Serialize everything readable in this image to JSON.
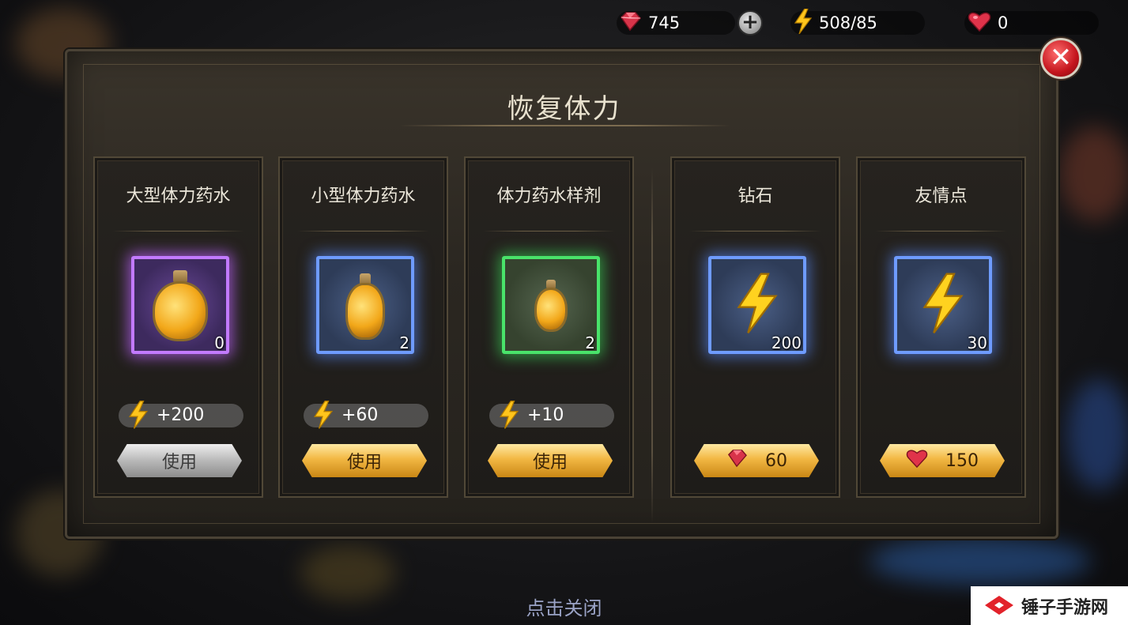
{
  "topbar": {
    "gems": "745",
    "energy": "508/85",
    "friendship": "0"
  },
  "dialog": {
    "title": "恢复体力",
    "close_hint": "点击关闭"
  },
  "items": [
    {
      "name": "大型体力药水",
      "count": "0",
      "bonus": "+200",
      "button": "使用",
      "rarity": "purple",
      "button_state": "disabled"
    },
    {
      "name": "小型体力药水",
      "count": "2",
      "bonus": "+60",
      "button": "使用",
      "rarity": "blue",
      "button_state": "enabled"
    },
    {
      "name": "体力药水样剂",
      "count": "2",
      "bonus": "+10",
      "button": "使用",
      "rarity": "green",
      "button_state": "enabled"
    }
  ],
  "purchases": [
    {
      "name": "钻石",
      "amount": "200",
      "cost": "60",
      "cost_icon": "gem-icon"
    },
    {
      "name": "友情点",
      "amount": "30",
      "cost": "150",
      "cost_icon": "heart-icon"
    }
  ],
  "watermark": {
    "text": "锤子手游网"
  },
  "colors": {
    "gold_button": "#f2b743",
    "gray_button": "#b8b8b8",
    "purple_frame": "#c27aff",
    "blue_frame": "#6e9bff",
    "green_frame": "#49e36a",
    "close_red": "#c4151d"
  }
}
